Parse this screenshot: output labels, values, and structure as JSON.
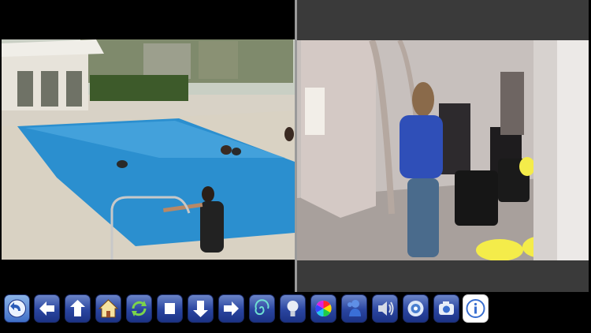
{
  "cameras": {
    "left": {
      "name": "pool-camera",
      "overlay_text": "",
      "overlay_text_right": ""
    },
    "right": {
      "name": "salon-camera"
    }
  },
  "toolbar": {
    "buttons": [
      {
        "id": "back",
        "icon": "back-arrow-icon"
      },
      {
        "id": "left",
        "icon": "arrow-left-icon"
      },
      {
        "id": "up",
        "icon": "arrow-up-icon"
      },
      {
        "id": "home",
        "icon": "home-icon"
      },
      {
        "id": "refresh",
        "icon": "refresh-icon"
      },
      {
        "id": "stop",
        "icon": "stop-icon"
      },
      {
        "id": "down",
        "icon": "arrow-down-icon"
      },
      {
        "id": "right",
        "icon": "arrow-right-icon"
      },
      {
        "id": "ptz",
        "icon": "ptz-spiral-icon"
      },
      {
        "id": "light",
        "icon": "lightbulb-icon"
      },
      {
        "id": "color",
        "icon": "color-wheel-icon"
      },
      {
        "id": "talk",
        "icon": "person-talk-icon"
      },
      {
        "id": "audio",
        "icon": "speaker-icon"
      },
      {
        "id": "record",
        "icon": "record-icon"
      },
      {
        "id": "snapshot",
        "icon": "camera-icon"
      },
      {
        "id": "info",
        "icon": "info-icon"
      }
    ]
  },
  "colors": {
    "toolbar_blue": "#2a45a0",
    "background": "#000000",
    "pool_water": "#2b8fcf"
  }
}
